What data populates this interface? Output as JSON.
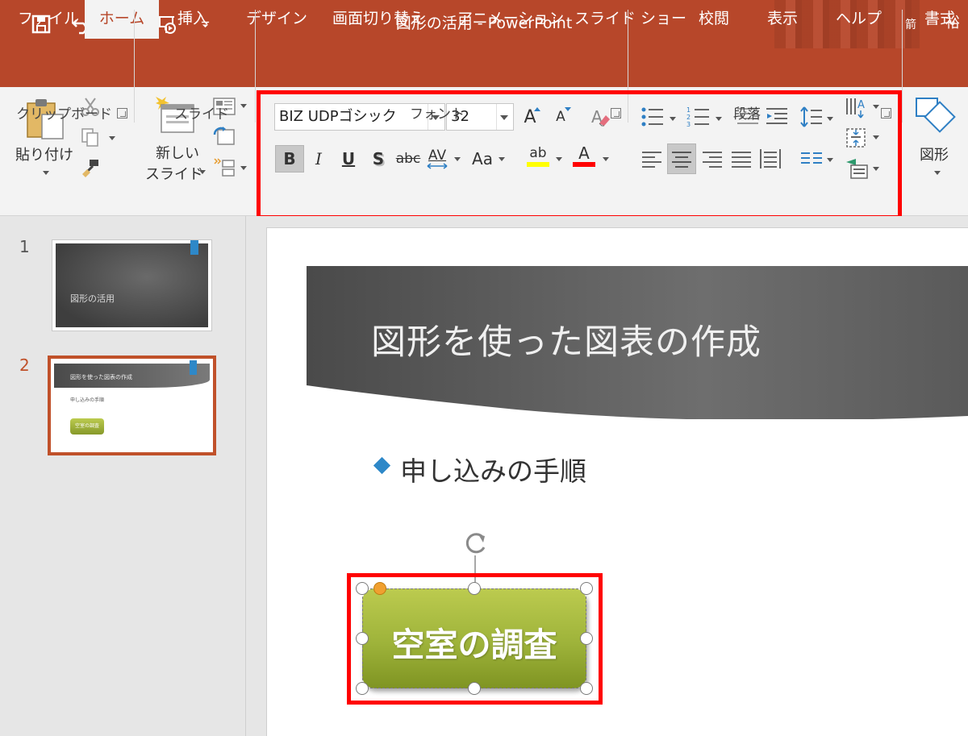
{
  "window": {
    "title": "図形の活用  -  PowerPoint",
    "user_a": "箭",
    "user_b": "裕"
  },
  "qat": {
    "save": "save-icon",
    "undo": "undo-icon",
    "redo": "redo-icon",
    "present": "present-from-start-icon",
    "customize": "customize-qat-icon"
  },
  "tabs": [
    "ファイル",
    "ホーム",
    "挿入",
    "デザイン",
    "画面切り替え",
    "アニメーション",
    "スライド ショー",
    "校閲",
    "表示",
    "ヘルプ",
    "書式"
  ],
  "active_tab": "ホーム",
  "ribbon": {
    "clipboard": {
      "label": "クリップボード",
      "paste": "貼り付け"
    },
    "slides": {
      "label": "スライド",
      "new_slide_1": "新しい",
      "new_slide_2": "スライド"
    },
    "font": {
      "label": "フォント",
      "font_name": "BIZ UDPゴシック",
      "font_size": "32",
      "bold": "B",
      "italic": "I",
      "underline": "U",
      "shadow": "S",
      "strike": "abc",
      "spacing": "AV",
      "case": "Aa",
      "highlight": "ab",
      "font_color": "A",
      "grow": "A",
      "shrink": "A"
    },
    "paragraph": {
      "label": "段落"
    },
    "drawing": {
      "shapes": "図形"
    }
  },
  "thumbnails": [
    {
      "number": "1",
      "title": "図形の活用"
    },
    {
      "number": "2",
      "title": "図形を使った図表の作成",
      "bullet": "申し込みの手順",
      "shape": "空室の調査"
    }
  ],
  "slide": {
    "title": "図形を使った図表の作成",
    "bullet": "申し込みの手順",
    "shape_text": "空室の調査"
  },
  "colors": {
    "accent": "#b7472a",
    "highlight_box": "#ff0000",
    "shape_green": "#9eb33a",
    "bullet_blue": "#2e88c8"
  }
}
